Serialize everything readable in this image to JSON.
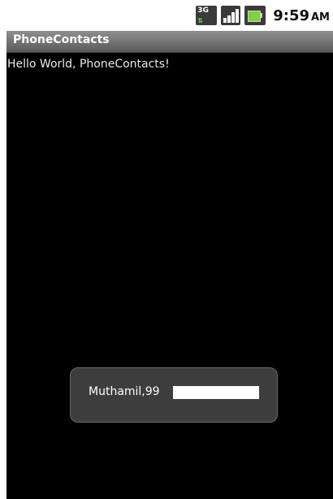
{
  "status_bar": {
    "network_label": "3G",
    "time": "9:59",
    "ampm": "AM"
  },
  "app": {
    "title": "PhoneContacts",
    "hello_text": "Hello World, PhoneContacts!"
  },
  "toast": {
    "message": "Muthamil,99"
  },
  "colors": {
    "title_bar": "#6e6e6e",
    "content_bg": "#000000",
    "toast_bg": "#3d3d3d"
  }
}
